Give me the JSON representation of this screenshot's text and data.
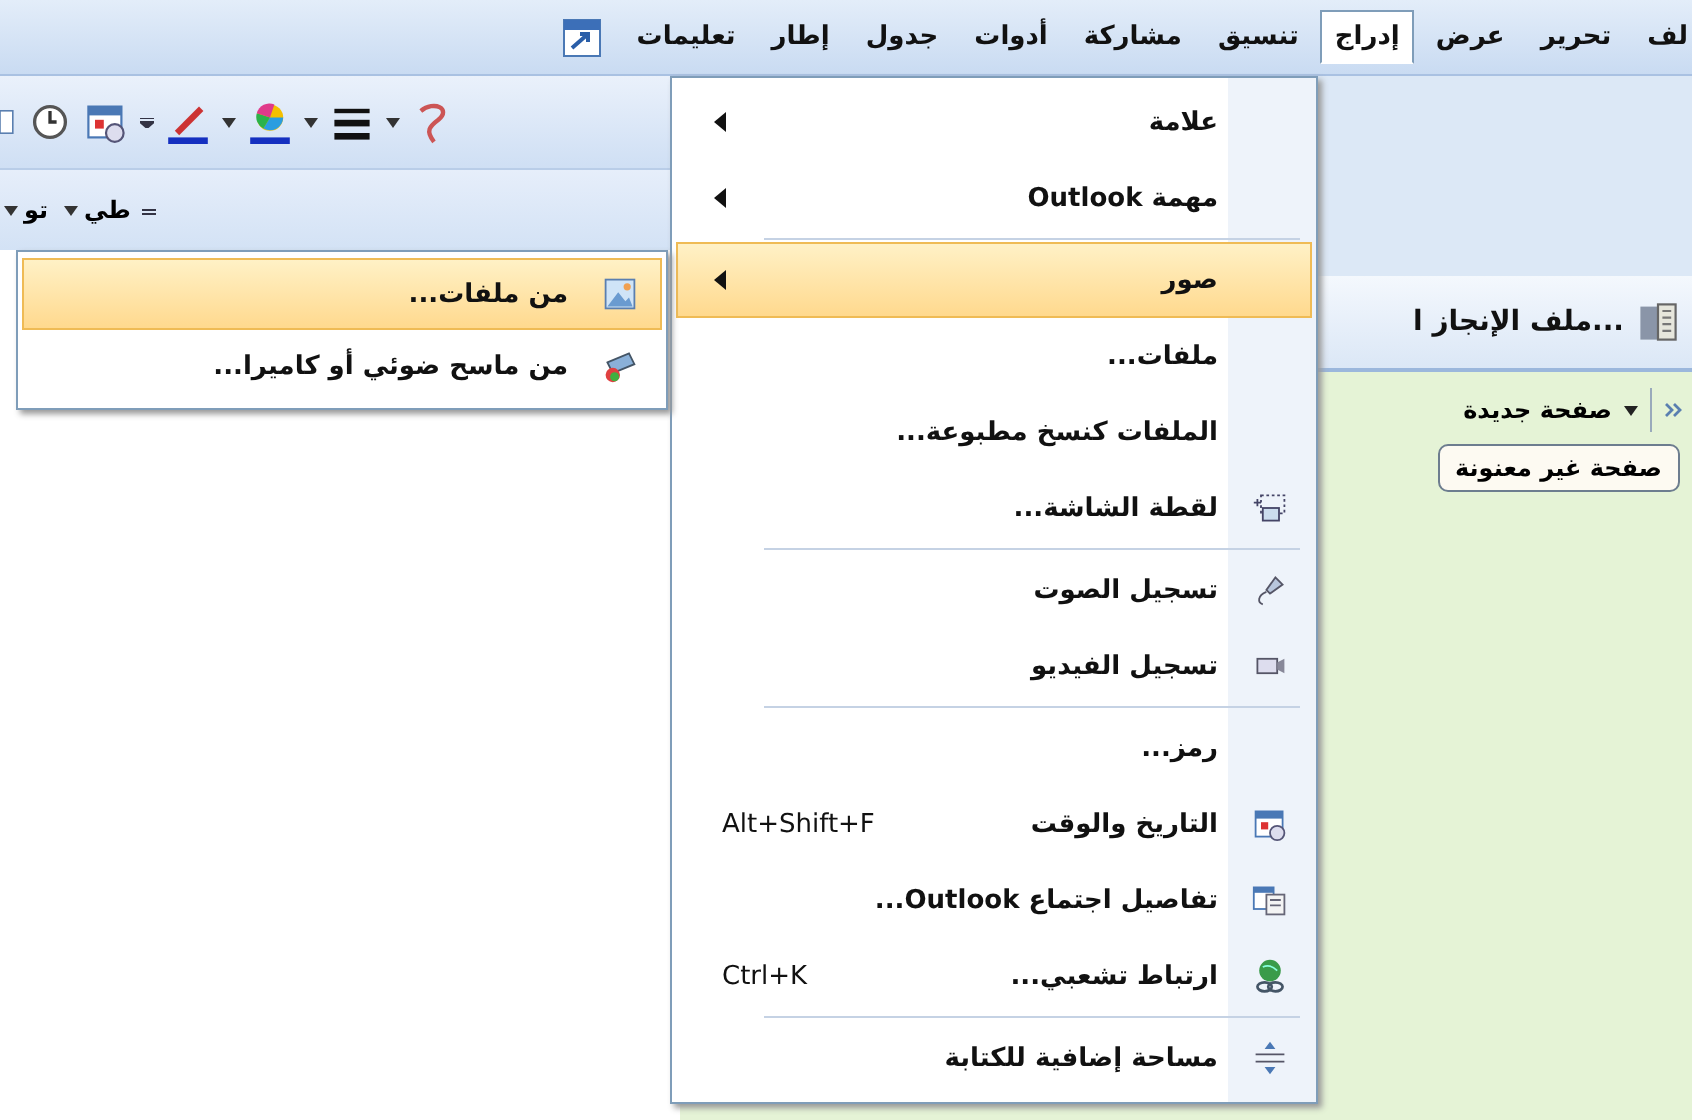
{
  "menubar": {
    "items": [
      {
        "label": "لف",
        "selected": false
      },
      {
        "label": "تحرير",
        "selected": false
      },
      {
        "label": "عرض",
        "selected": false
      },
      {
        "label": "إدراج",
        "selected": true
      },
      {
        "label": "تنسيق",
        "selected": false
      },
      {
        "label": "مشاركة",
        "selected": false
      },
      {
        "label": "أدوات",
        "selected": false
      },
      {
        "label": "جدول",
        "selected": false
      },
      {
        "label": "إطار",
        "selected": false
      },
      {
        "label": "تعليمات",
        "selected": false
      }
    ]
  },
  "toolbar": {
    "dropdowns": [
      "طي",
      "تو"
    ]
  },
  "notebook": {
    "title": "ملف الإنجاز ا...",
    "section_tab": "صفحة جديدة",
    "page": "صفحة غير معنونة"
  },
  "menu": {
    "items": [
      {
        "kind": "item",
        "label": "علامة",
        "submenu": true,
        "selected": false
      },
      {
        "kind": "item",
        "label": "مهمة Outlook",
        "submenu": true,
        "selected": false
      },
      {
        "kind": "separator"
      },
      {
        "kind": "item",
        "label": "صور",
        "submenu": true,
        "selected": true
      },
      {
        "kind": "item",
        "label": "ملفات...",
        "submenu": false,
        "selected": false
      },
      {
        "kind": "item",
        "label": "الملفات كنسخ مطبوعة...",
        "submenu": false,
        "selected": false
      },
      {
        "kind": "item",
        "label": "لقطة الشاشة...",
        "submenu": false,
        "selected": false
      },
      {
        "kind": "separator"
      },
      {
        "kind": "item",
        "label": "تسجيل الصوت",
        "submenu": false,
        "selected": false
      },
      {
        "kind": "item",
        "label": "تسجيل الفيديو",
        "submenu": false,
        "selected": false
      },
      {
        "kind": "separator"
      },
      {
        "kind": "item",
        "label": "رمز...",
        "submenu": false,
        "selected": false
      },
      {
        "kind": "item",
        "label": "التاريخ والوقت",
        "shortcut": "Alt+Shift+F",
        "submenu": false,
        "selected": false
      },
      {
        "kind": "item",
        "label": "تفاصيل اجتماع Outlook...",
        "submenu": false,
        "selected": false
      },
      {
        "kind": "item",
        "label": "ارتباط تشعبي...",
        "shortcut": "Ctrl+K",
        "submenu": false,
        "selected": false
      },
      {
        "kind": "separator"
      },
      {
        "kind": "item",
        "label": "مساحة إضافية للكتابة",
        "submenu": false,
        "selected": false
      }
    ]
  },
  "submenu": {
    "items": [
      {
        "label": "من ملفات...",
        "selected": true
      },
      {
        "label": "من ماسح ضوئي أو كاميرا...",
        "selected": false
      }
    ]
  }
}
